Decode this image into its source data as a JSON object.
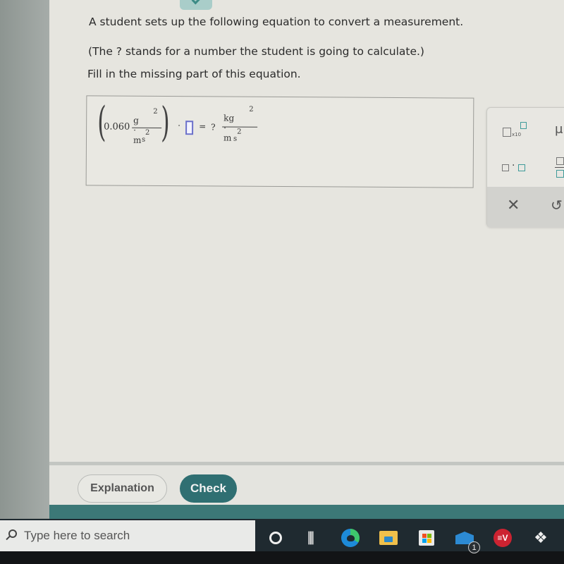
{
  "question": {
    "line1": "A student sets up the following equation to convert a measurement.",
    "line2": "(The ? stands for a number the student is going to calculate.)",
    "line3": "Fill in the missing part of this equation."
  },
  "equation": {
    "coefficient": "0.060",
    "left_numerator": "g · m",
    "left_numerator_exp": "2",
    "left_denominator": "s",
    "left_denominator_exp": "2",
    "dot": "·",
    "equals": "=",
    "unknown": "?",
    "right_numerator": "kg · m",
    "right_numerator_exp": "2",
    "right_denominator": "s",
    "right_denominator_exp": "2"
  },
  "palette": {
    "sci_notation_label": "x10",
    "mu_label": "μ",
    "multiply_dot": "·",
    "clear_symbol": "✕",
    "undo_symbol": "↺"
  },
  "footer": {
    "explanation_label": "Explanation",
    "check_label": "Check"
  },
  "taskbar": {
    "search_placeholder": "Type here to search",
    "mail_badge_count": "1",
    "vpn_label": "≡V"
  }
}
